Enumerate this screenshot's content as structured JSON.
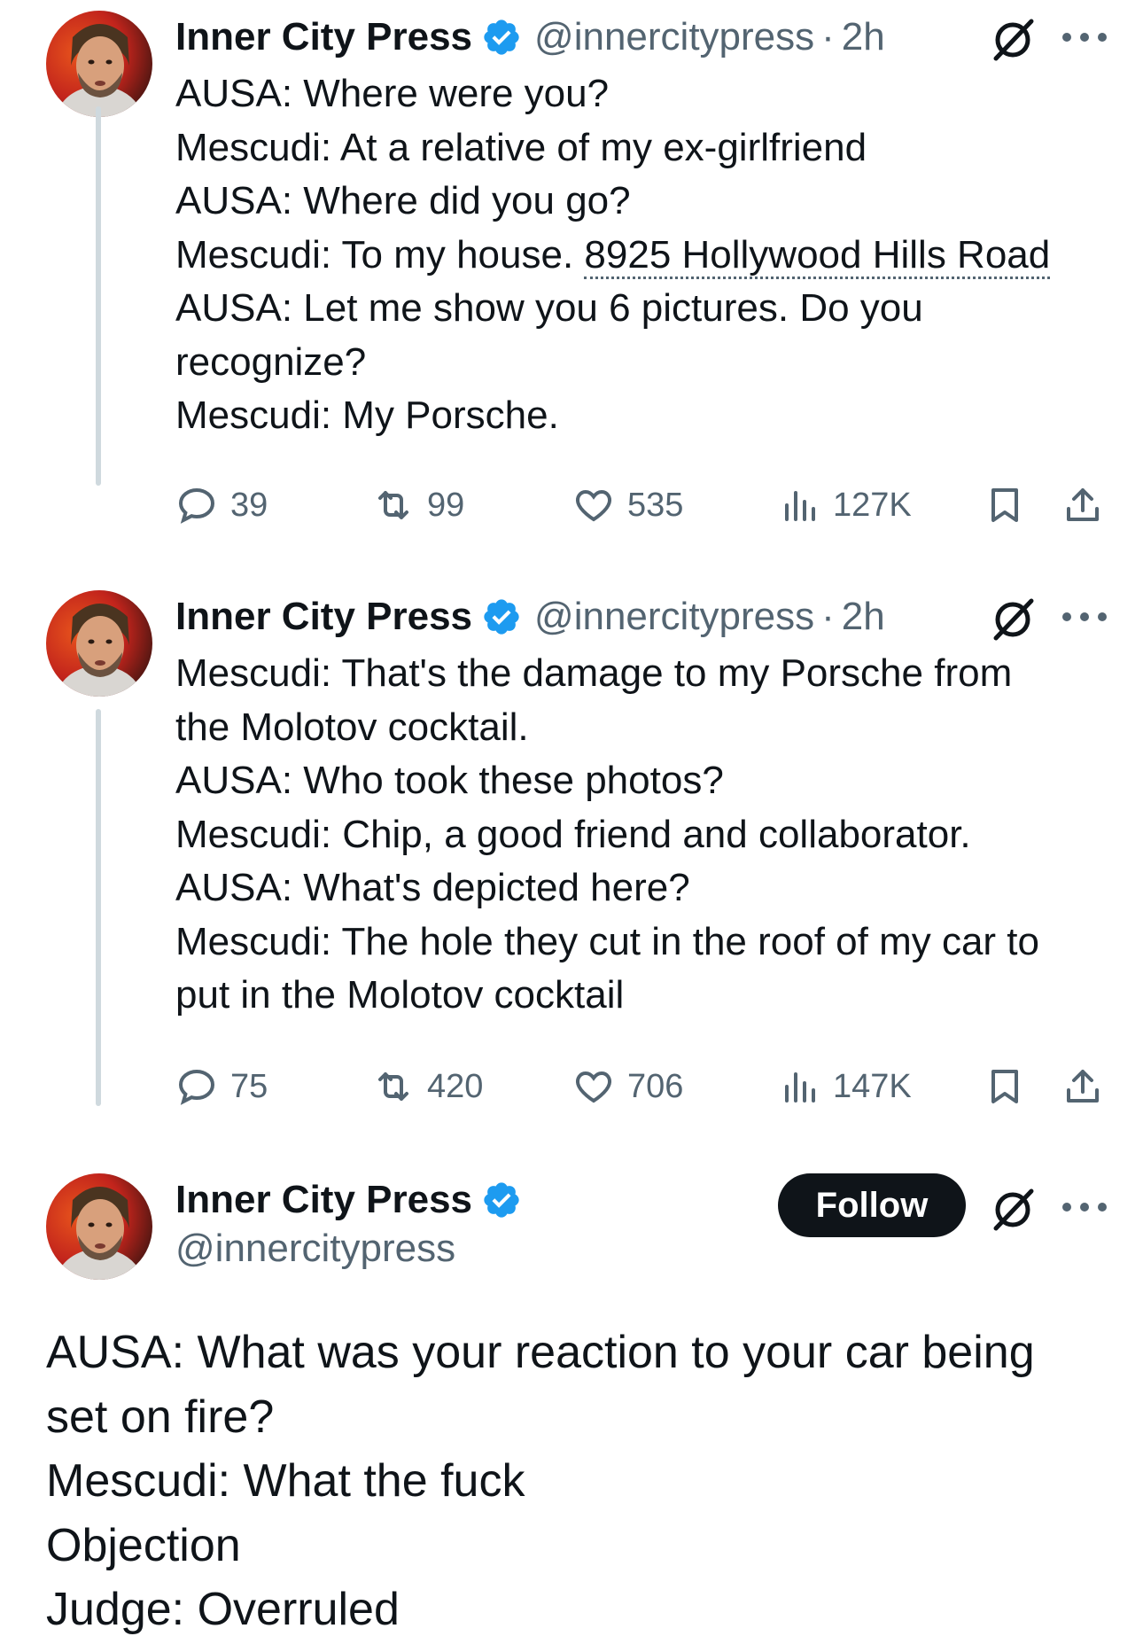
{
  "author": {
    "name": "Inner City Press",
    "handle": "@innercitypress",
    "verified": true,
    "avatar_icon": "person-avatar"
  },
  "colors": {
    "text": "#0f1419",
    "muted": "#536471",
    "verified": "#1d9bf0",
    "thread_line": "#cfd9de",
    "follow_bg": "#0f1419"
  },
  "tweets": [
    {
      "time": "2h",
      "lines": [
        "AUSA: Where were you?",
        "Mescudi: At a relative of my ex-girlfriend",
        "AUSA: Where did you go?",
        "Mescudi: To my house. ",
        "AUSA: Let me show you 6 pictures. Do you",
        "recognize?",
        "Mescudi: My Porsche."
      ],
      "address_link": "8925 Hollywood Hills Road",
      "stats": {
        "replies": "39",
        "reposts": "99",
        "likes": "535",
        "views": "127K"
      }
    },
    {
      "time": "2h",
      "lines": [
        "Mescudi: That's the damage to my Porsche from",
        "the Molotov cocktail.",
        "AUSA: Who took these photos?",
        "Mescudi: Chip, a good friend and collaborator.",
        "AUSA: What's depicted here?",
        "Mescudi: The hole they cut in the roof of my car to",
        "put in the Molotov cocktail"
      ],
      "stats": {
        "replies": "75",
        "reposts": "420",
        "likes": "706",
        "views": "147K"
      }
    },
    {
      "follow_label": "Follow",
      "lines": [
        "AUSA: What was your reaction to your car being",
        "set on fire?",
        "Mescudi: What the fuck",
        "Objection",
        "Judge: Overruled"
      ]
    }
  ]
}
